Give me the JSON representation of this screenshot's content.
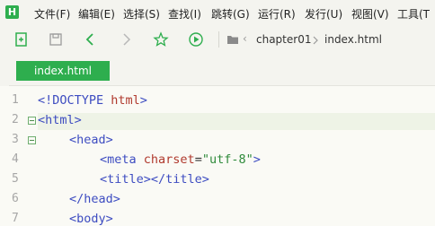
{
  "app": {
    "logo_letter": "H"
  },
  "menu": [
    {
      "label": "文件(F)"
    },
    {
      "label": "编辑(E)"
    },
    {
      "label": "选择(S)"
    },
    {
      "label": "查找(I)"
    },
    {
      "label": "跳转(G)"
    },
    {
      "label": "运行(R)"
    },
    {
      "label": "发行(U)"
    },
    {
      "label": "视图(V)"
    },
    {
      "label": "工具(T"
    }
  ],
  "toolbar": {
    "icons": [
      "new-file-icon",
      "save-icon",
      "back-icon",
      "forward-icon",
      "favorite-icon",
      "run-icon"
    ],
    "breadcrumb": [
      "chapter01",
      "index.html"
    ],
    "breadcrumb_prefix": "‹"
  },
  "tabs": [
    {
      "label": "index.html",
      "active": true
    }
  ],
  "editor": {
    "line_numbers": [
      "1",
      "2",
      "3",
      "4",
      "5",
      "6",
      "7"
    ],
    "lines": [
      {
        "tokens": [
          {
            "t": "tag",
            "v": "<!DOCTYPE "
          },
          {
            "t": "attr",
            "v": "html"
          },
          {
            "t": "tag",
            "v": ">"
          }
        ]
      },
      {
        "tokens": [
          {
            "t": "tag",
            "v": "<html>"
          }
        ]
      },
      {
        "tokens": [
          {
            "t": "tag",
            "v": "<head>"
          }
        ]
      },
      {
        "tokens": [
          {
            "t": "tag",
            "v": "<meta "
          },
          {
            "t": "attr",
            "v": "charset"
          },
          {
            "t": "eq",
            "v": "="
          },
          {
            "t": "val",
            "v": "\"utf-8\""
          },
          {
            "t": "tag",
            "v": ">"
          }
        ]
      },
      {
        "tokens": [
          {
            "t": "tag",
            "v": "<title></title>"
          }
        ]
      },
      {
        "tokens": [
          {
            "t": "tag",
            "v": "</head>"
          }
        ]
      },
      {
        "tokens": [
          {
            "t": "tag",
            "v": "<body>"
          }
        ]
      }
    ]
  },
  "colors": {
    "accent": "#2eae4e",
    "tag": "#3d4cc1",
    "attr": "#b03a2e",
    "value": "#2e8a3a"
  }
}
